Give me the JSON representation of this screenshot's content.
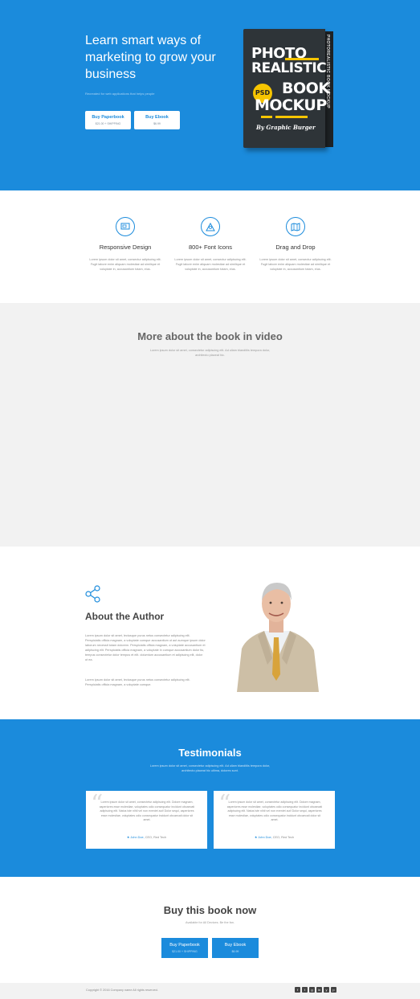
{
  "hero": {
    "title": "Learn smart ways of marketing to grow your business",
    "subtitle": "Recreated for web applications that helps people",
    "buttons": [
      {
        "label": "Buy Paperbook",
        "price": "$21.00 + SHIPPING"
      },
      {
        "label": "Buy Ebook",
        "price": "$6.99"
      }
    ],
    "book": {
      "line1": "PHOTO",
      "line2": "REALISTIC",
      "line3": "BOOK",
      "line4": "MOCKUP",
      "badge": "PSD",
      "by": "By Graphic Burger",
      "spine": "PHOTOREALISTIC BOOK MOCKUP"
    }
  },
  "features": [
    {
      "icon": "responsive-design-icon",
      "title": "Responsive Design",
      "text": "Lorem ipsum dolor sit amet, consectur adipiscing elit. Fugit labore enim aliquam molestiae ad similique et voluptate in, accusantium totam, eius."
    },
    {
      "icon": "font-icons-icon",
      "title": "800+ Font Icons",
      "text": "Lorem ipsum dolor sit amet, consectur adipiscing elit. Fugit labore enim aliquam molestiae ad similique et voluptate in, accusantium totam, eius."
    },
    {
      "icon": "drag-drop-icon",
      "title": "Drag and Drop",
      "text": "Lorem ipsum dolor sit amet, consectur adipiscing elit. Fugit labore enim aliquam molestiae ad similique et voluptate in, accusantium totam, eius."
    }
  ],
  "video": {
    "title": "More about the book in video",
    "subtitle": "Lorem ipsum dolor sit amet, consectetur adipiscing elit. Ad ullam blanditiis tempora dolor, architecto placeat hic."
  },
  "author": {
    "title": "About the Author",
    "para1": "Lorem ipsum dolor sit amet, lectusque purus netus consectetur adipiscing elit. Perspiciatis officia magnam, a voluptate cumque accusantium ut aut aumque ipsum dolor laborum necessit totam dolorem. Perspiciatis officia magnam, a voluptate accusantium et adipiscing elit. Perspiciatis officia magnam, a voluptate in cumque accusantium dolor tiu, tempus consectetur dolor tempus et elit. dolumtum accusantium et adipiscing elit, dolor ut ea.",
    "para2": "Lorem ipsum dolor sit amet, lectusque purus netus consectetur adipiscing elit. Perspiciatis officia magnam, a voluptate cumque."
  },
  "testimonials": {
    "title": "Testimonials",
    "subtitle": "Lorem ipsum dolor sit amet, consectetur adipiscing elit. Ad ullam blanditiis tempora dolor, architecto placeat hic ultima, dolores sunt.",
    "items": [
      {
        "text": "Lorem ipsum dolor sit amet, consectetur adipiscing elit. Dolore magnam, asperiores esse molestiae, voluptates odio consequatur incidunt obcaecati adipiscing elit. Natus iste nihil vel non eveniet aut! Dolor sequi, asperiores esse molestiae, voluptates odio consequatur incidunt obcaecati dolor sit amet.",
        "name": "★ John Doe,",
        "role": "CEO, Red Tech"
      },
      {
        "text": "Lorem ipsum dolor sit amet, consectetur adipiscing elit. Dolore magnam, asperiores esse molestiae, voluptates odio consequatur incidunt obcaecati adipiscing elit. Natus iste nihil vel non eveniet aut! Dolor sequi, asperiores esse molestiae, voluptates odio consequatur incidunt obcaecati dolor sit amet.",
        "name": "★ John Doe,",
        "role": "CEO, Red Tech"
      }
    ]
  },
  "buy": {
    "title": "Buy this book now",
    "subtitle": "Available for All Devices. Be the fan.",
    "buttons": [
      {
        "label": "Buy Paperbook",
        "price": "$21.00 + SHIPPING"
      },
      {
        "label": "Buy Ebook",
        "price": "$6.99"
      }
    ]
  },
  "footer": {
    "copyright": "Copyright © 2016 Company name All rights reserved.",
    "social": [
      "f",
      "t",
      "g",
      "in",
      "y",
      "p"
    ]
  },
  "colors": {
    "primary": "#1b8bdc",
    "light_bg": "#f2f2f2",
    "book_cover": "#2e3438",
    "book_accent": "#f6c500"
  }
}
